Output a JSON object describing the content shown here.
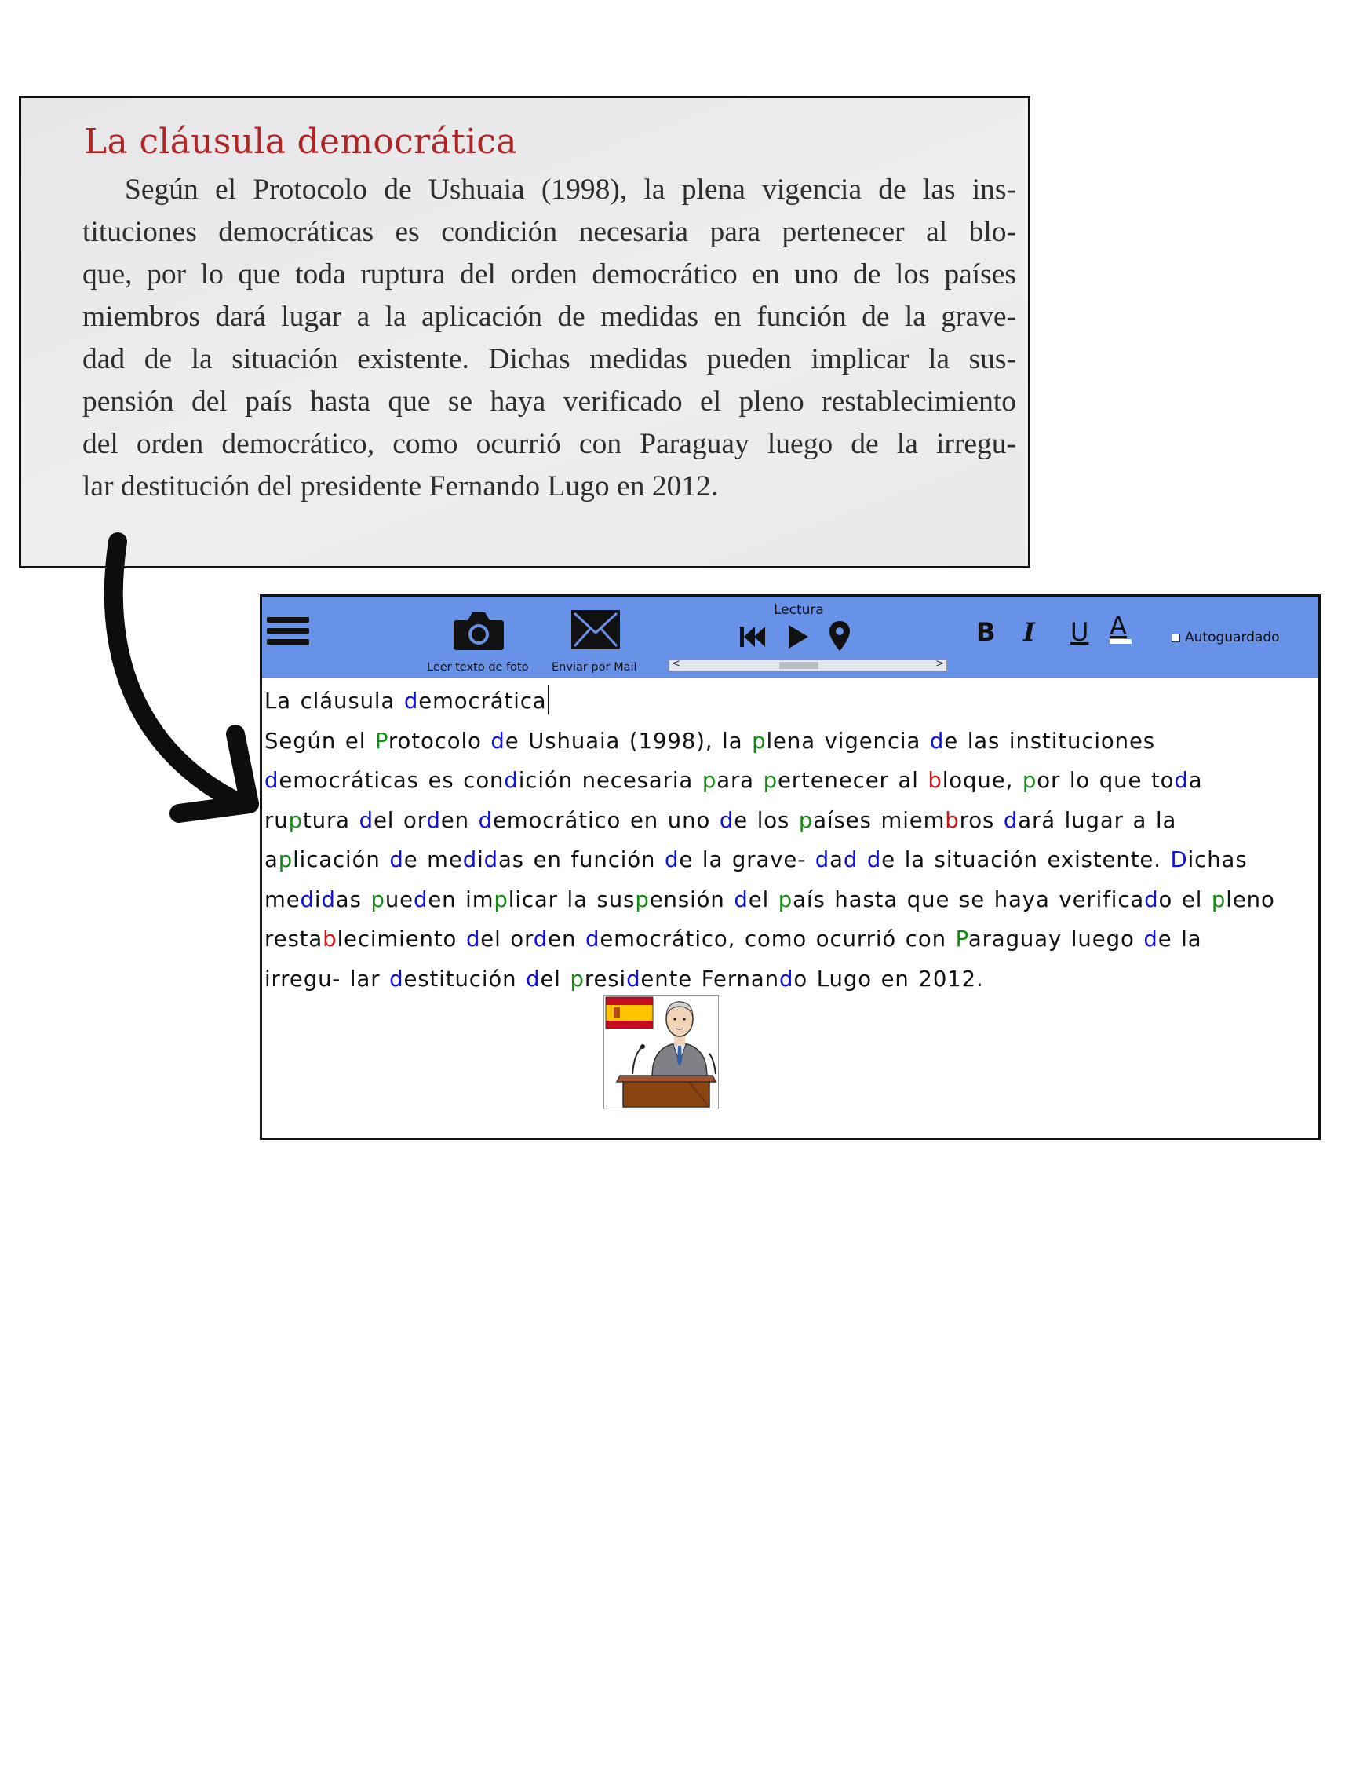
{
  "book_excerpt": {
    "title": "La cláusula democrática",
    "lines": [
      "Según el Protocolo de Ushuaia (1998), la plena vigencia de las ins-",
      "tituciones democráticas es condición necesaria para pertenecer al blo-",
      "que, por lo que toda ruptura del orden democrático en uno de los países",
      "miembros dará lugar a la aplicación de medidas en función de la grave-",
      "dad de la situación existente. Dichas medidas pueden implicar la sus-",
      "pensión del país hasta que se haya verificado el pleno restablecimiento",
      "del orden democrático, como ocurrió con Paraguay luego de la irregu-",
      "lar destitución del presidente Fernando Lugo en 2012."
    ]
  },
  "toolbar": {
    "menu_icon": "hamburger-menu-icon",
    "camera_label": "Leer texto de foto",
    "mail_label": "Enviar por Mail",
    "reading_title": "Lectura",
    "bold_label": "B",
    "italic_label": "I",
    "underline_label": "U",
    "color_label": "A",
    "autosave_label": "Autoguardado",
    "autosave_checked": false,
    "scroll_left": "<",
    "scroll_right": ">"
  },
  "document": {
    "title": "La cláusula democrática",
    "lines": [
      "Según el Protocolo de Ushuaia (1998), la plena vigencia de las instituciones",
      "democráticas es condición necesaria para pertenecer al bloque, por lo que toda",
      "ruptura del orden democrático en uno de los países miembros dará lugar a la",
      "aplicación de medidas en función de la grave- dad de la situación existente. Dichas",
      "medidas pueden implicar la suspensión del país hasta que se haya verificado el pleno",
      "restablecimiento del orden democrático, como ocurrió con Paraguay luego de la",
      "irregu- lar destitución del presidente Fernando Lugo en 2012."
    ],
    "letter_colors": {
      "b": "#1111dd",
      "d": "#1111dd",
      "p": "#158a15",
      "P": "#158a15",
      "D": "#1111dd"
    }
  },
  "colors": {
    "toolbar": "#6891e8",
    "book_title": "#b02626",
    "highlight_blue": "#1111dd",
    "highlight_green": "#158a15",
    "highlight_red": "#dd1010"
  },
  "pictogram": {
    "icon": "president-speaking-at-podium-with-spanish-flag-pictogram"
  }
}
